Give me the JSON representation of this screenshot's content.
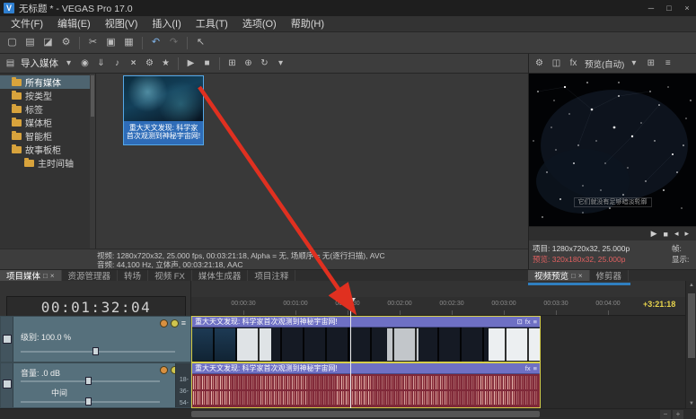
{
  "colors": {
    "accent_blue": "#2f7fc0",
    "selection_yellow": "#d6cf4a",
    "track_header": "#56707c",
    "waveform_red": "#7e2838",
    "event_title_purple": "#6e70c4",
    "arrow_red": "#e03020",
    "preview_info_red": "#e06060"
  },
  "title_bar": {
    "logo_letter": "V",
    "title": "无标题 * - VEGAS Pro 17.0",
    "minimize": "─",
    "maximize": "□",
    "close": "×"
  },
  "menu_bar": {
    "items": [
      "文件(F)",
      "编辑(E)",
      "视图(V)",
      "插入(I)",
      "工具(T)",
      "选项(O)",
      "帮助(H)"
    ]
  },
  "main_toolbar": {
    "icons": [
      {
        "name": "new-project-icon",
        "glyph": "▢"
      },
      {
        "name": "open-project-icon",
        "glyph": "▤"
      },
      {
        "name": "save-project-icon",
        "glyph": "◪"
      },
      {
        "name": "project-properties-icon",
        "glyph": "⚙"
      },
      {
        "name": "cut-icon",
        "glyph": "✂"
      },
      {
        "name": "copy-icon",
        "glyph": "▣"
      },
      {
        "name": "paste-icon",
        "glyph": "▦"
      },
      {
        "name": "undo-icon",
        "glyph": "↶"
      },
      {
        "name": "redo-icon",
        "glyph": "↷"
      },
      {
        "name": "edit-tool-icon",
        "glyph": "↖"
      }
    ]
  },
  "media_panel": {
    "toolbar": {
      "media_list_icon": "▤",
      "import_label": "导入媒体",
      "dropdown_arrow": "▾",
      "capture_icon": "◉",
      "download_icon": "⇓",
      "extract_icon": "♪",
      "delete_icon": "×",
      "properties_icon": "⚙",
      "smart_icon": "★",
      "play_icon": "▶",
      "stop_icon": "■",
      "views_icon": "⊞",
      "zoom_icon": "⊕",
      "refresh_icon": "↻",
      "more_icon": "▾"
    },
    "tree": {
      "items": [
        {
          "label": "所有媒体"
        },
        {
          "label": "按类型"
        },
        {
          "label": "标签"
        },
        {
          "label": "媒体柜"
        },
        {
          "label": "智能柜"
        },
        {
          "label": "故事板柜"
        },
        {
          "label": "主时间轴"
        }
      ]
    },
    "clip": {
      "caption_line1": "重大天文发现: 科学家",
      "caption_line2": "首次观测到神秘宇宙网!"
    },
    "info_video": "视频: 1280x720x32, 25.000 fps, 00:03:21:18, Alpha = 无, 场顺序 = 无(逐行扫描), AVC",
    "info_audio": "音频: 44,100 Hz, 立体声, 00:03:21:18, AAC",
    "tabs": [
      {
        "label": "项目媒体"
      },
      {
        "label": "资源管理器"
      },
      {
        "label": "转场"
      },
      {
        "label": "视频 FX"
      },
      {
        "label": "媒体生成器"
      },
      {
        "label": "项目注释"
      }
    ],
    "tab_window_icon": "□",
    "tab_close_icon": "×"
  },
  "preview_panel": {
    "toolbar": {
      "gear_icon": "⚙",
      "split_icon": "◫",
      "fx_icon": "fx",
      "preview_quality_label": "预览(自动)",
      "dropdown_arrow": "▾",
      "grid_icon": "⊞",
      "menu_icon": "≡"
    },
    "overlay_text": "它们就没有足够暗淡轮廓",
    "transport": {
      "play_icon": "▶",
      "stop_icon": "■",
      "prev_icon": "◂",
      "next_icon": "▸"
    },
    "info_project": "项目: 1280x720x32, 25.000p",
    "info_preview": "预览: 320x180x32, 25.000p",
    "info_frame_label": "帧:",
    "info_display_label": "显示:",
    "tabs": [
      {
        "label": "视频预览"
      },
      {
        "label": "修剪器"
      }
    ],
    "tab_window_icon": "□",
    "tab_close_icon": "×"
  },
  "timeline": {
    "timecode": "00:01:32:04",
    "loop_offset": "+3:21:18",
    "ruler_ticks": [
      "00:00:30",
      "00:01:00",
      "00:01:30",
      "00:02:00",
      "00:02:30",
      "00:03:00",
      "00:03:30",
      "00:04:00"
    ],
    "video_track": {
      "level_label": "级别: 100.0 %",
      "menu_icon": "≡"
    },
    "audio_track": {
      "volume_label": "音量: .0 dB",
      "pan_label": "中间",
      "menu_icon": "≡",
      "meter_scale": [
        "18-",
        "36-",
        "54-"
      ]
    },
    "video_event_title": "重大天文发现: 科学家首次观测到神秘宇宙网!",
    "audio_event_title": "重大天文发现: 科学家首次观测到神秘宇宙网!",
    "event_icons": {
      "crop_icon": "⊡",
      "fx_icon": "fx",
      "menu_icon": "≡"
    },
    "zoom_in_icon": "+",
    "zoom_out_icon": "−"
  }
}
